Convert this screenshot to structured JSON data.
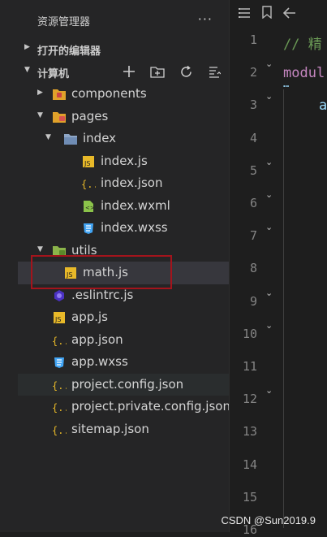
{
  "explorer": {
    "title": "资源管理器",
    "more": "···",
    "open_editors": "打开的编辑器",
    "project_section": "计算机"
  },
  "tree": [
    {
      "name": "components",
      "depth": 1,
      "twisty": "right",
      "icon": "folder-components-icon"
    },
    {
      "name": "pages",
      "depth": 1,
      "twisty": "down",
      "icon": "folder-pages-icon"
    },
    {
      "name": "index",
      "depth": 2,
      "twisty": "down",
      "icon": "folder-open-icon"
    },
    {
      "name": "index.js",
      "depth": 3,
      "icon": "js-file-icon"
    },
    {
      "name": "index.json",
      "depth": 3,
      "icon": "json-file-icon"
    },
    {
      "name": "index.wxml",
      "depth": 3,
      "icon": "wxml-file-icon"
    },
    {
      "name": "index.wxss",
      "depth": 3,
      "icon": "wxss-file-icon"
    },
    {
      "name": "utils",
      "depth": 1,
      "twisty": "down",
      "icon": "folder-utils-icon"
    },
    {
      "name": "math.js",
      "depth": 2,
      "icon": "js-file-icon",
      "selected": true
    },
    {
      "name": ".eslintrc.js",
      "depth": 1,
      "icon": "eslint-file-icon"
    },
    {
      "name": "app.js",
      "depth": 1,
      "icon": "js-file-icon"
    },
    {
      "name": "app.json",
      "depth": 1,
      "icon": "json-file-icon"
    },
    {
      "name": "app.wxss",
      "depth": 1,
      "icon": "wxss-file-icon"
    },
    {
      "name": "project.config.json",
      "depth": 1,
      "icon": "json-file-icon",
      "hover": true
    },
    {
      "name": "project.private.config.json",
      "depth": 1,
      "icon": "json-file-icon"
    },
    {
      "name": "sitemap.json",
      "depth": 1,
      "icon": "json-file-icon"
    }
  ],
  "editor": {
    "line_numbers": [
      "1",
      "2",
      "3",
      "4",
      "5",
      "6",
      "7",
      "8",
      "9",
      "10",
      "11",
      "12",
      "13",
      "14",
      "15",
      "16"
    ],
    "code_line1": "// 精",
    "code_line2": "modul",
    "code_line3": "a"
  },
  "colors": {
    "comment": "#6a9955",
    "keyword": "#c586c0",
    "identifier": "#9cdcfe",
    "selection_box": "#a3141c"
  },
  "watermark": "CSDN @Sun2019.9"
}
